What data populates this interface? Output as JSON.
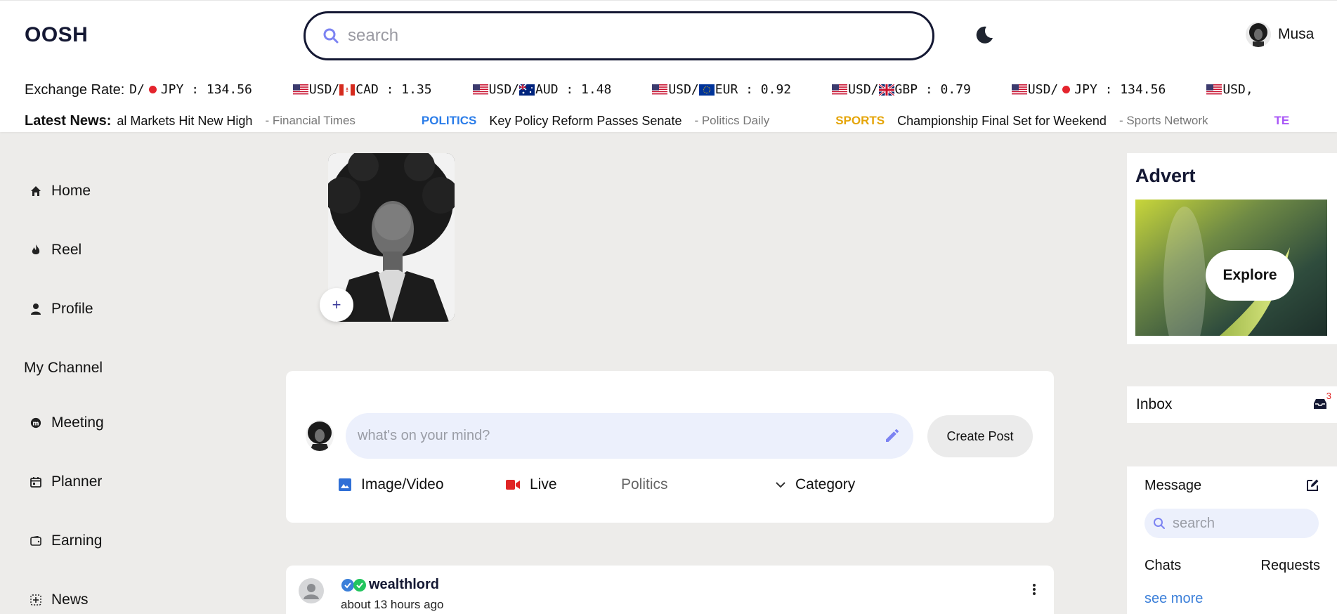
{
  "header": {
    "logo": "OOSH",
    "search_placeholder": "search",
    "user_name": "Musa"
  },
  "exchange": {
    "label": "Exchange Rate:",
    "leading": {
      "text": "SD/",
      "quote": "JPY",
      "value": ": 134.56"
    },
    "rates": [
      {
        "base": "USD/",
        "quote": "CAD",
        "value": ": 1.35",
        "flag": "ca"
      },
      {
        "base": "USD/",
        "quote": "AUD",
        "value": ": 1.48",
        "flag": "au"
      },
      {
        "base": "USD/",
        "quote": "EUR",
        "value": ": 0.92",
        "flag": "eu"
      },
      {
        "base": "USD/",
        "quote": "GBP",
        "value": ": 0.79",
        "flag": "gb"
      },
      {
        "base": "USD/",
        "quote": "JPY",
        "value": ": 134.56",
        "flag": "jp"
      }
    ],
    "trailing": "USD,"
  },
  "news": {
    "label": "Latest News:",
    "items": [
      {
        "category": "",
        "headline": "al Markets Hit New High",
        "source": "- Financial Times",
        "color": "#2b7de9"
      },
      {
        "category": "POLITICS",
        "headline": "Key Policy Reform Passes Senate",
        "source": "- Politics Daily",
        "color": "#2b7de9"
      },
      {
        "category": "SPORTS",
        "headline": "Championship Final Set for Weekend",
        "source": "- Sports Network",
        "color": "#e5a50a"
      },
      {
        "category": "TE",
        "headline": "",
        "source": "",
        "color": "#a855f7"
      }
    ]
  },
  "sidebar": {
    "items": [
      {
        "label": "Home",
        "icon": "home-icon"
      },
      {
        "label": "Reel",
        "icon": "fire-icon"
      },
      {
        "label": "Profile",
        "icon": "user-icon"
      },
      {
        "label": "My Channel",
        "icon": ""
      },
      {
        "label": "Meeting",
        "icon": "meeting-icon"
      },
      {
        "label": "Planner",
        "icon": "calendar-icon"
      },
      {
        "label": "Earning",
        "icon": "wallet-icon"
      },
      {
        "label": "News",
        "icon": "news-icon"
      }
    ]
  },
  "story": {
    "add_label": "+"
  },
  "create_post": {
    "placeholder": "what's on your mind?",
    "button": "Create Post",
    "options": {
      "image_video": "Image/Video",
      "live": "Live",
      "politics": "Politics",
      "category": "Category"
    }
  },
  "post": {
    "author": "wealthlord",
    "time": "about 13 hours ago"
  },
  "advert": {
    "title": "Advert",
    "button": "Explore"
  },
  "inbox": {
    "label": "Inbox",
    "count": "3"
  },
  "messages": {
    "title": "Message",
    "search_placeholder": "search",
    "chats": "Chats",
    "requests": "Requests",
    "see_more": "see more"
  },
  "colors": {
    "brand_dark": "#141833",
    "accent_blue": "#3b7fd9",
    "input_bg": "#ecf0fc",
    "live_red": "#e02424",
    "image_blue": "#2f6fd6",
    "pen_purple": "#7c83f2"
  }
}
